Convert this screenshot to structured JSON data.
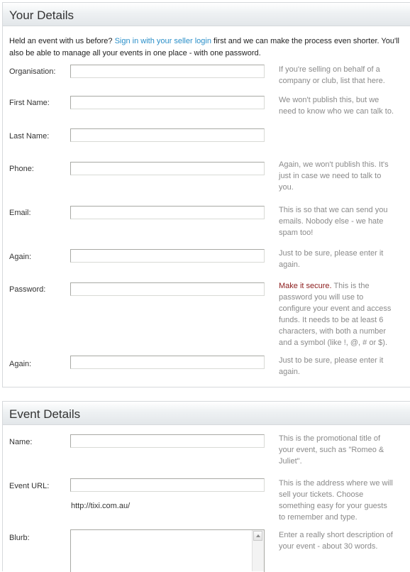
{
  "your_details": {
    "title": "Your Details",
    "intro_before": "Held an event with us before? ",
    "intro_link": "Sign in with your seller login",
    "intro_after": " first and we can make the process even shorter. You'll also be able to manage all your events in one place - with one password.",
    "organisation": {
      "label": "Organisation:",
      "value": "",
      "hint": "If you're selling on behalf of a company or club, list that here."
    },
    "first_name": {
      "label": "First Name:",
      "value": "",
      "hint": "We won't publish this, but we need to know who we can talk to."
    },
    "last_name": {
      "label": "Last Name:",
      "value": ""
    },
    "phone": {
      "label": "Phone:",
      "value": "",
      "hint": "Again, we won't publish this. It's just in case we need to talk to you."
    },
    "email": {
      "label": "Email:",
      "value": "",
      "hint": "This is so that we can send you emails. Nobody else - we hate spam too!"
    },
    "email_again": {
      "label": "Again:",
      "value": "",
      "hint": "Just to be sure, please enter it again."
    },
    "password": {
      "label": "Password:",
      "value": "",
      "hint_strong": "Make it secure.",
      "hint": " This is the password you will use to configure your event and access funds. It needs to be at least 6 characters, with both a number and a symbol (like !, @, # or $)."
    },
    "password_again": {
      "label": "Again:",
      "value": "",
      "hint": "Just to be sure, please enter it again."
    }
  },
  "event_details": {
    "title": "Event Details",
    "name": {
      "label": "Name:",
      "value": "",
      "hint": "This is the promotional title of your event, such as \"Romeo & Juliet\"."
    },
    "event_url": {
      "label": "Event URL:",
      "value": "",
      "prefix": "http://tixi.com.au/",
      "hint": "This is the address where we will sell your tickets. Choose something easy for your guests to remember and type."
    },
    "blurb": {
      "label": "Blurb:",
      "value": "",
      "hint": "Enter a really short description of your event - about 30 words."
    }
  }
}
